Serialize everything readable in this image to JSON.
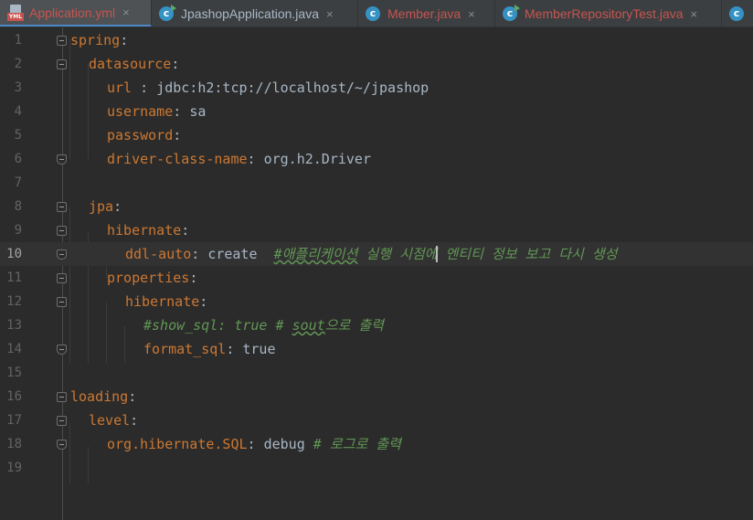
{
  "tabs": [
    {
      "label": "Application.yml",
      "icon": "yml-file-icon",
      "color": "#c75450",
      "close": "×"
    },
    {
      "label": "JpashopApplication.java",
      "icon": "java-class-run-icon",
      "color": "#a9b7c6",
      "close": "×"
    },
    {
      "label": "Member.java",
      "icon": "java-class-icon",
      "color": "#c75450",
      "close": "×"
    },
    {
      "label": "MemberRepositoryTest.java",
      "icon": "java-class-run-icon",
      "color": "#c75450",
      "close": "×"
    },
    {
      "label": "",
      "icon": "java-class-icon",
      "color": "#a9b7c6",
      "close": ""
    }
  ],
  "editor": {
    "current_line": 10,
    "lines": [
      {
        "n": "1",
        "key": "spring",
        "sep": ":",
        "val": "",
        "comment": ""
      },
      {
        "n": "2",
        "key": "datasource",
        "sep": ":",
        "val": "",
        "comment": ""
      },
      {
        "n": "3",
        "key": "url",
        "sep": " : ",
        "val": "jdbc:h2:tcp://localhost/~/jpashop",
        "comment": ""
      },
      {
        "n": "4",
        "key": "username",
        "sep": ": ",
        "val": "sa",
        "comment": ""
      },
      {
        "n": "5",
        "key": "password",
        "sep": ":",
        "val": "",
        "comment": ""
      },
      {
        "n": "6",
        "key": "driver-class-name",
        "sep": ": ",
        "val": "org.h2.Driver",
        "comment": ""
      },
      {
        "n": "7",
        "key": "",
        "sep": "",
        "val": "",
        "comment": ""
      },
      {
        "n": "8",
        "key": "jpa",
        "sep": ":",
        "val": "",
        "comment": ""
      },
      {
        "n": "9",
        "key": "hibernate",
        "sep": ":",
        "val": "",
        "comment": ""
      },
      {
        "n": "10",
        "key": "ddl-auto",
        "sep": ": ",
        "val": "create  ",
        "comment_a": "#애플리케이션",
        "comment_b": " 실행 시점에",
        "comment_c": " 엔티티 정보 보고 다시 생성"
      },
      {
        "n": "11",
        "key": "properties",
        "sep": ":",
        "val": "",
        "comment": ""
      },
      {
        "n": "12",
        "key": "hibernate",
        "sep": ":",
        "val": "",
        "comment": ""
      },
      {
        "n": "13",
        "key": "",
        "sep": "",
        "val": "",
        "comment_a": "#show_sql: true # ",
        "comment_b": "sout",
        "comment_c": "으로 출력"
      },
      {
        "n": "14",
        "key": "format_sql",
        "sep": ": ",
        "val": "true",
        "comment": ""
      },
      {
        "n": "15",
        "key": "",
        "sep": "",
        "val": "",
        "comment": ""
      },
      {
        "n": "16",
        "key": "loading",
        "sep": ":",
        "val": "",
        "comment": ""
      },
      {
        "n": "17",
        "key": "level",
        "sep": ":",
        "val": "",
        "comment": ""
      },
      {
        "n": "18",
        "key": "org.hibernate.SQL",
        "sep": ": ",
        "val": "debug ",
        "comment": "# 로그로 출력"
      },
      {
        "n": "19",
        "key": "",
        "sep": "",
        "val": "",
        "comment": ""
      }
    ]
  }
}
